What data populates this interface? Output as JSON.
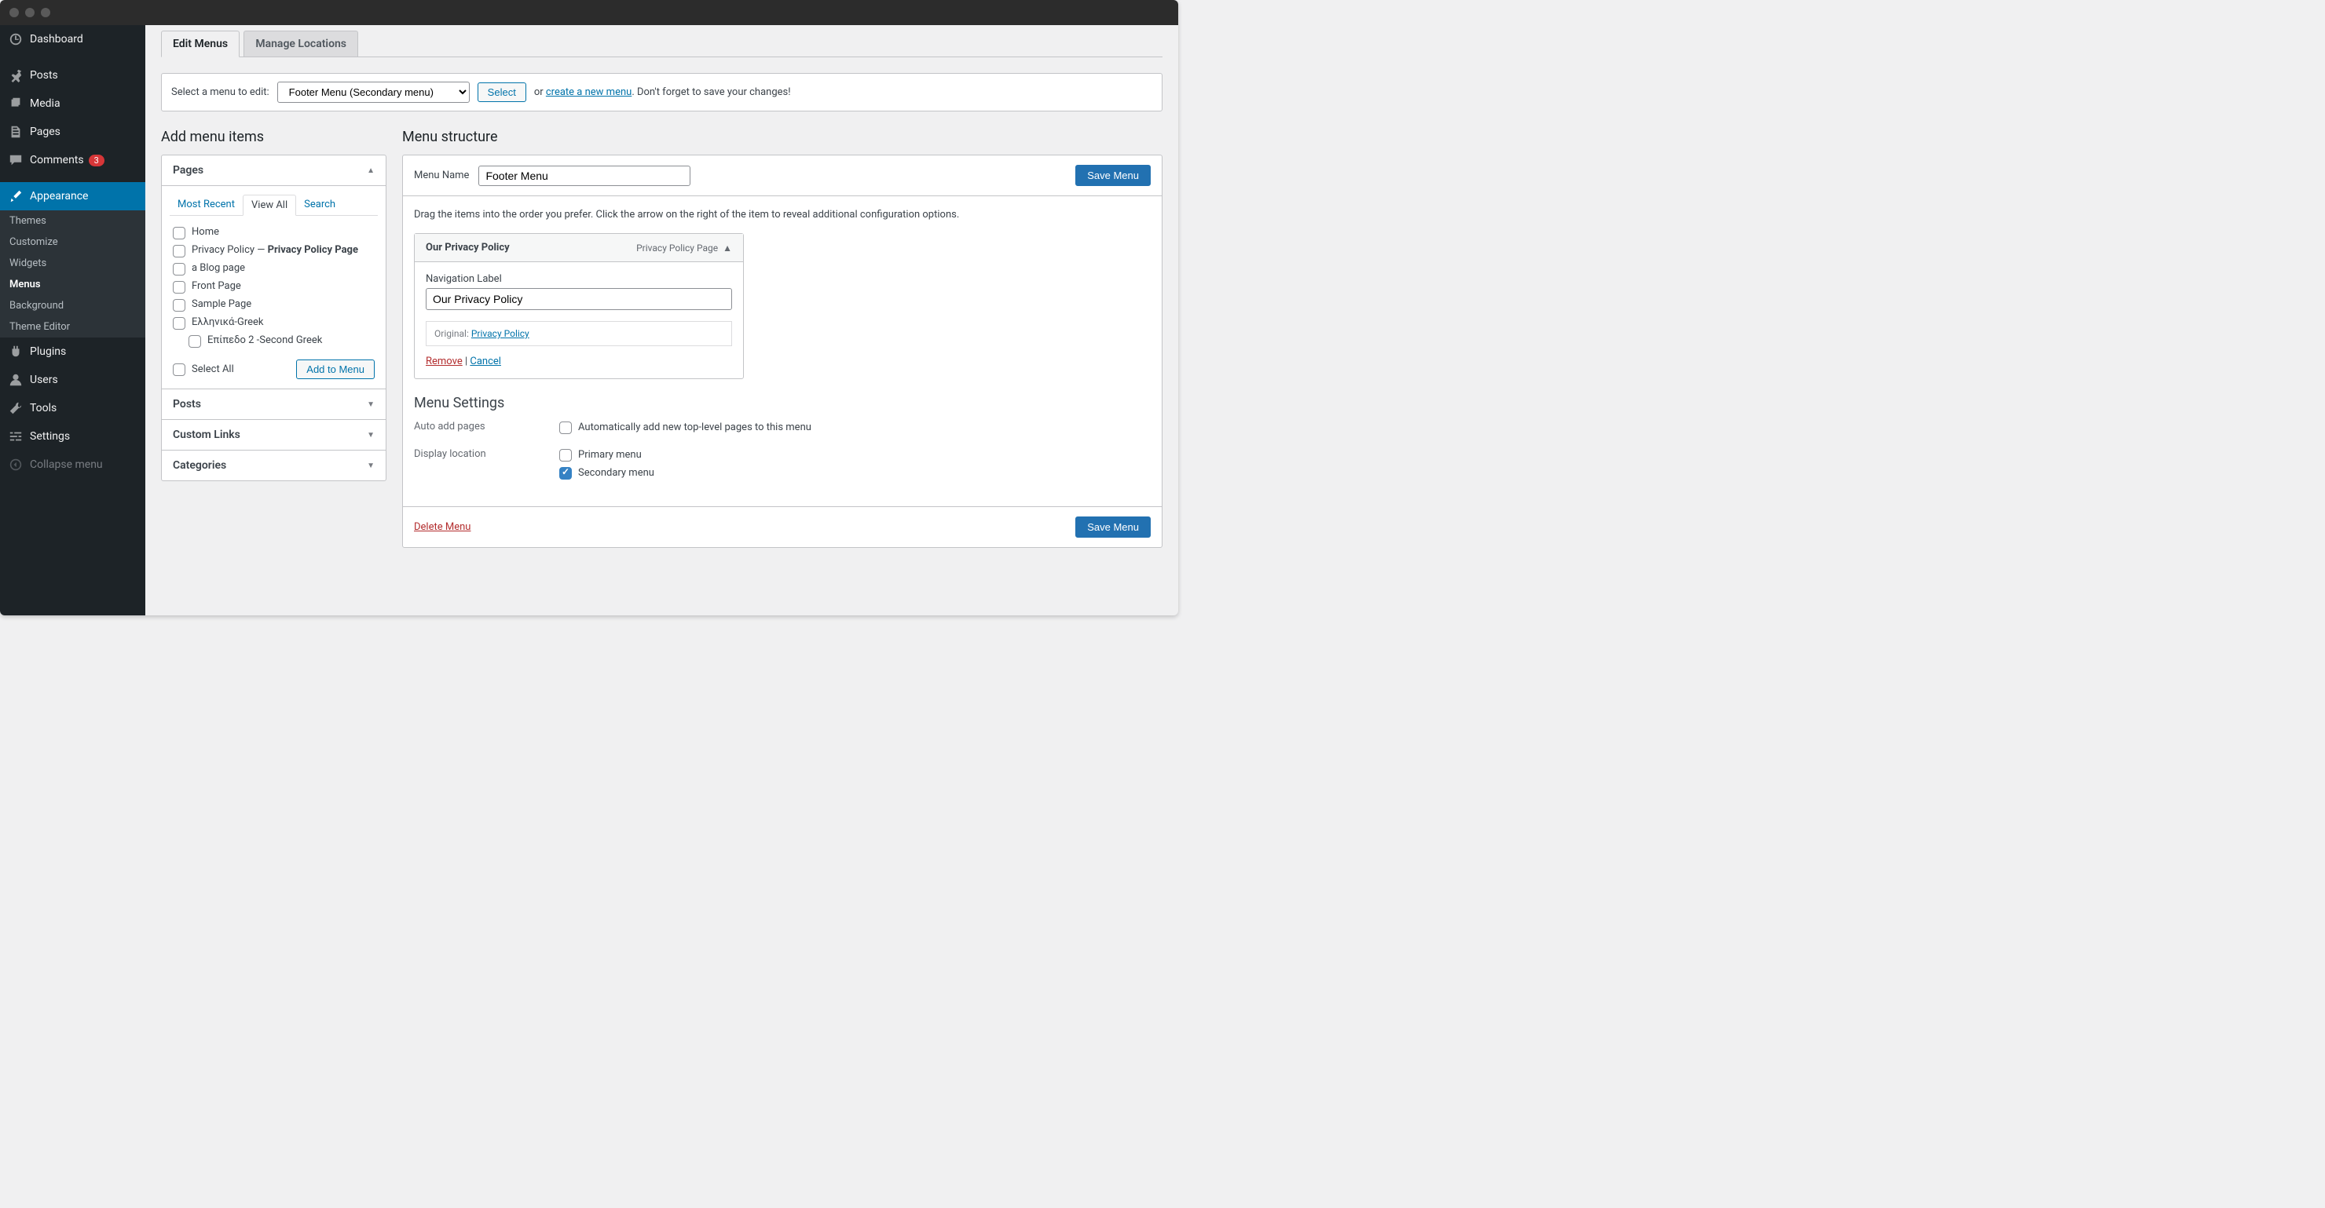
{
  "sidebar": {
    "items": [
      {
        "label": "Dashboard"
      },
      {
        "label": "Posts"
      },
      {
        "label": "Media"
      },
      {
        "label": "Pages"
      },
      {
        "label": "Comments",
        "badge": "3"
      },
      {
        "label": "Appearance"
      },
      {
        "label": "Plugins"
      },
      {
        "label": "Users"
      },
      {
        "label": "Tools"
      },
      {
        "label": "Settings"
      }
    ],
    "appearance_sub": [
      "Themes",
      "Customize",
      "Widgets",
      "Menus",
      "Background",
      "Theme Editor"
    ],
    "collapse": "Collapse menu"
  },
  "tabs": {
    "edit": "Edit Menus",
    "manage": "Manage Locations"
  },
  "selectbar": {
    "label": "Select a menu to edit:",
    "selected": "Footer Menu (Secondary menu)",
    "select_btn": "Select",
    "or": "or",
    "create": "create a new menu",
    "suffix": ". Don't forget to save your changes!"
  },
  "add_items": {
    "title": "Add menu items",
    "pages": "Pages",
    "inner_tabs": {
      "recent": "Most Recent",
      "viewall": "View All",
      "search": "Search"
    },
    "list": [
      {
        "label": "Home"
      },
      {
        "label": "Privacy Policy",
        "suffix_sep": " — ",
        "suffix_bold": "Privacy Policy Page"
      },
      {
        "label": "a Blog page"
      },
      {
        "label": "Front Page"
      },
      {
        "label": "Sample Page"
      },
      {
        "label": "Ελληνικά-Greek"
      },
      {
        "label": "Επίπεδο 2 -Second Greek",
        "indent": true
      }
    ],
    "select_all": "Select All",
    "add_btn": "Add to Menu",
    "posts": "Posts",
    "custom": "Custom Links",
    "categories": "Categories"
  },
  "structure": {
    "title": "Menu structure",
    "name_label": "Menu Name",
    "name_value": "Footer Menu",
    "save": "Save Menu",
    "instruction": "Drag the items into the order you prefer. Click the arrow on the right of the item to reveal additional configuration options.",
    "item": {
      "title": "Our Privacy Policy",
      "type": "Privacy Policy Page",
      "nav_label": "Navigation Label",
      "nav_value": "Our Privacy Policy",
      "orig_label": "Original:",
      "orig_link": "Privacy Policy",
      "remove": "Remove",
      "sep": " | ",
      "cancel": "Cancel"
    },
    "settings": {
      "title": "Menu Settings",
      "auto_label": "Auto add pages",
      "auto_opt": "Automatically add new top-level pages to this menu",
      "loc_label": "Display location",
      "primary": "Primary menu",
      "secondary": "Secondary menu"
    },
    "delete": "Delete Menu"
  }
}
